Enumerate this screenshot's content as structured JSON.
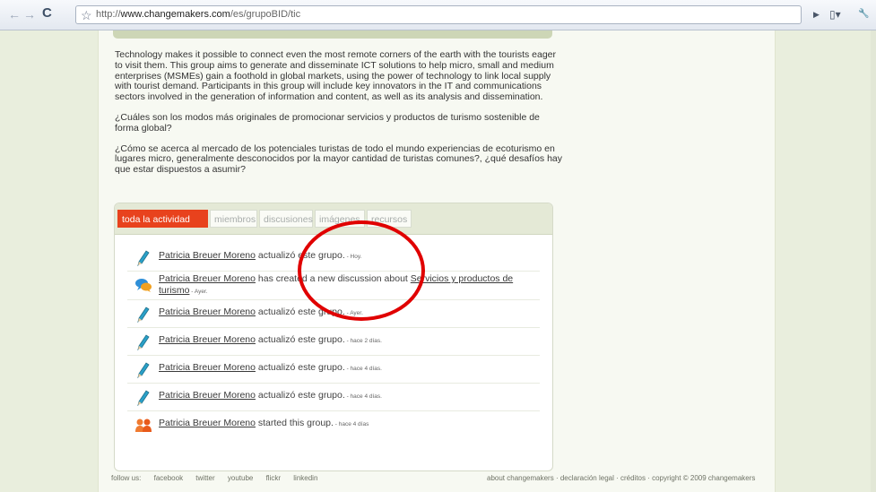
{
  "browser": {
    "url_prefix": "http://",
    "url_domain": "www.changemakers.com",
    "url_path": "/es/grupoBID/tic",
    "back_glyph": "←",
    "forward_glyph": "→",
    "reload_glyph": "C",
    "star_glyph": "☆",
    "go_glyph": "▶",
    "page_glyph": "▯▾",
    "tools_glyph": "🔧"
  },
  "description": {
    "p1": "Technology makes it possible to connect even the most remote corners of the earth with the tourists eager to visit them. This group aims to generate and disseminate ICT solutions to help micro, small and medium enterprises (MSMEs) gain a foothold in global markets, using the power of technology to link local supply with tourist demand. Participants in this group will include key innovators in the IT and communications sectors involved in the generation of information and content, as well as its analysis and dissemination.",
    "p2": "¿Cuáles son los modos más originales de promocionar servicios y productos de turismo sostenible de forma global?",
    "p3": "¿Cómo se acerca al mercado de los potenciales turistas de todo el mundo experiencias de ecoturismo en lugares micro, generalmente desconocidos por la mayor cantidad de turistas comunes?, ¿qué desafíos hay que estar dispuestos a asumir?"
  },
  "tabs": [
    "toda la actividad",
    "miembros",
    "discusiones",
    "imágenes",
    "recursos"
  ],
  "activity": [
    {
      "user": "Patricia Breuer Moreno",
      "action": " actualizó este grupo.",
      "time": " - Hoy."
    },
    {
      "user": "Patricia Breuer Moreno",
      "action": " has created a new discussion about ",
      "link2": "Servicios y productos de turismo",
      "time": " - Ayer."
    },
    {
      "user": "Patricia Breuer Moreno",
      "action": " actualizó este grupo.",
      "time": " - Ayer."
    },
    {
      "user": "Patricia Breuer Moreno",
      "action": " actualizó este grupo.",
      "time": " - hace 2 días."
    },
    {
      "user": "Patricia Breuer Moreno",
      "action": " actualizó este grupo.",
      "time": " - hace 4 días."
    },
    {
      "user": "Patricia Breuer Moreno",
      "action": " actualizó este grupo.",
      "time": " - hace 4 días."
    },
    {
      "user": "Patricia Breuer Moreno",
      "action": " started this group.",
      "time": " - hace 4 días"
    }
  ],
  "footer": {
    "left": [
      "follow us:",
      "facebook",
      "twitter",
      "youtube",
      "flickr",
      "linkedin"
    ],
    "right": "about changemakers · declaración legal · créditos · copyright © 2009 changemakers"
  },
  "colors": {
    "accent": "#e8421d",
    "annotation": "#e00000"
  }
}
